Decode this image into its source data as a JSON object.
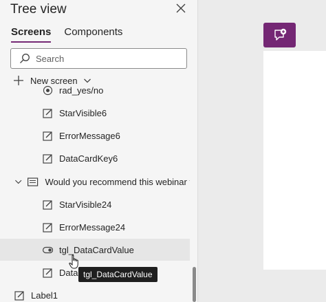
{
  "panel": {
    "title": "Tree view",
    "tabs": [
      {
        "label": "Screens",
        "active": true
      },
      {
        "label": "Components",
        "active": false
      }
    ],
    "search_placeholder": "Search",
    "new_screen_label": "New screen"
  },
  "tree": {
    "items": [
      {
        "label": "rad_yes/no",
        "icon": "radio-icon"
      },
      {
        "label": "StarVisible6",
        "icon": "edit-icon"
      },
      {
        "label": "ErrorMessage6",
        "icon": "edit-icon"
      },
      {
        "label": "DataCardKey6",
        "icon": "edit-icon"
      },
      {
        "label": "Would you recommend this webinar to",
        "icon": "card-icon",
        "expanded": true
      },
      {
        "label": "StarVisible24",
        "icon": "edit-icon"
      },
      {
        "label": "ErrorMessage24",
        "icon": "edit-icon"
      },
      {
        "label": "tgl_DataCardValue",
        "icon": "toggle-icon",
        "hovered": true
      },
      {
        "label": "DataC",
        "icon": "edit-icon"
      },
      {
        "label": "Label1",
        "icon": "edit-icon"
      }
    ]
  },
  "tooltip": {
    "text": "tgl_DataCardValue"
  },
  "colors": {
    "accent": "#742774",
    "panel_bg": "#f5f5f5",
    "canvas_bg": "#ebebeb"
  }
}
